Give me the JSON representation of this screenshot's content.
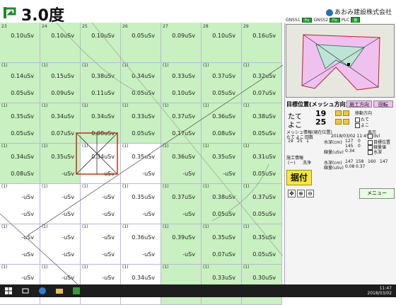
{
  "header": {
    "title": "3.0度",
    "brand": "あおみ建設株式会社"
  },
  "status": {
    "gnss1_label": "GNSS1",
    "gnss1_state": "Fix",
    "gnss2_label": "GNSS2",
    "gnss2_state": "Fix",
    "plc_label": "PLC",
    "plc_state": "接"
  },
  "grid": {
    "col_headers": [
      "23",
      "24",
      "25",
      "26",
      "27",
      "28",
      "29"
    ],
    "cell_marker": "(1)",
    "rows": [
      [
        {
          "v1": "0.10uSv",
          "v2": ""
        },
        {
          "v1": "0.10uSv",
          "v2": ""
        },
        {
          "v1": "0.10uSv",
          "v2": ""
        },
        {
          "v1": "0.05uSv",
          "v2": ""
        },
        {
          "v1": "0.09uSv",
          "v2": ""
        },
        {
          "v1": "0.10uSv",
          "v2": ""
        },
        {
          "v1": "0.16uSv",
          "v2": ""
        }
      ],
      [
        {
          "v1": "0.14uSv",
          "v2": "0.05uSv"
        },
        {
          "v1": "0.15uSv",
          "v2": "0.09uSv"
        },
        {
          "v1": "0.38uSv",
          "v2": "0.11uSv"
        },
        {
          "v1": "0.34uSv",
          "v2": "0.05uSv"
        },
        {
          "v1": "0.33uSv",
          "v2": "0.10uSv"
        },
        {
          "v1": "0.37uSv",
          "v2": "0.05uSv"
        },
        {
          "v1": "0.32uSv",
          "v2": "0.07uSv"
        }
      ],
      [
        {
          "v1": "0.35uSv",
          "v2": "0.05uSv"
        },
        {
          "v1": "0.34uSv",
          "v2": "0.07uSv"
        },
        {
          "v1": "0.34uSv",
          "v2": "0.08uSv"
        },
        {
          "v1": "0.33uSv",
          "v2": "0.05uSv"
        },
        {
          "v1": "0.37uSv",
          "v2": "0.17uSv"
        },
        {
          "v1": "0.36uSv",
          "v2": "0.08uSv"
        },
        {
          "v1": "0.38uSv",
          "v2": "0.05uSv"
        }
      ],
      [
        {
          "v1": "0.34uSv",
          "v2": "0.08uSv"
        },
        {
          "v1": "0.35uSv",
          "v2": "-uSv"
        },
        {
          "v1": "0.34uSv",
          "v2": "-uSv"
        },
        {
          "v1": "0.35uSv",
          "v2": "-uSv"
        },
        {
          "v1": "0.36uSv",
          "v2": "-uSv"
        },
        {
          "v1": "0.35uSv",
          "v2": "-uSv"
        },
        {
          "v1": "0.31uSv",
          "v2": "0.05uSv"
        }
      ],
      [
        {
          "v1": "-uSv",
          "v2": "-uSv"
        },
        {
          "v1": "-uSv",
          "v2": "-uSv"
        },
        {
          "v1": "-uSv",
          "v2": "-uSv"
        },
        {
          "v1": "0.35uSv",
          "v2": "-uSv"
        },
        {
          "v1": "0.37uSv",
          "v2": "-uSv"
        },
        {
          "v1": "0.38uSv",
          "v2": "0.05uSv"
        },
        {
          "v1": "0.37uSv",
          "v2": "0.05uSv"
        }
      ],
      [
        {
          "v1": "-uSv",
          "v2": "-uSv"
        },
        {
          "v1": "-uSv",
          "v2": "-uSv"
        },
        {
          "v1": "-uSv",
          "v2": "-uSv"
        },
        {
          "v1": "0.36uSv",
          "v2": "-uSv"
        },
        {
          "v1": "0.39uSv",
          "v2": "-uSv"
        },
        {
          "v1": "0.35uSv",
          "v2": "0.07uSv"
        },
        {
          "v1": "0.35uSv",
          "v2": "0.05uSv"
        }
      ],
      [
        {
          "v1": "-uSv",
          "v2": ""
        },
        {
          "v1": "-uSv",
          "v2": ""
        },
        {
          "v1": "-uSv",
          "v2": ""
        },
        {
          "v1": "0.34uSv",
          "v2": ""
        },
        {
          "v1": "",
          "v2": ""
        },
        {
          "v1": "0.33uSv",
          "v2": ""
        },
        {
          "v1": "0.30uSv",
          "v2": ""
        }
      ]
    ],
    "green": [
      [
        1,
        1,
        1,
        1,
        1,
        1,
        1
      ],
      [
        1,
        1,
        1,
        1,
        1,
        1,
        1
      ],
      [
        1,
        1,
        1,
        1,
        1,
        1,
        1
      ],
      [
        1,
        1,
        0,
        0,
        1,
        1,
        1
      ],
      [
        0,
        0,
        0,
        0,
        1,
        1,
        1
      ],
      [
        0,
        0,
        0,
        0,
        1,
        1,
        1
      ],
      [
        0,
        0,
        0,
        0,
        1,
        1,
        1
      ]
    ]
  },
  "panel": {
    "target_title": "目標位置(メッシュ方向)",
    "construction_dir_btn": "施工方向",
    "rotate_btn": "回転",
    "tate_label": "たて",
    "tate_value": "19",
    "yoko_label": "よこ",
    "yoko_value": "25",
    "move_dir_label": "移動方向",
    "move_tate": "たて",
    "move_yoko": "よこ",
    "mesh_info_title": "メッシュ情報(現在位置)",
    "mesh_tate": "たて",
    "mesh_yoko": "よこ",
    "mesh_count": "回数",
    "mesh_date": "2018/03/02 11:45",
    "mesh_tate_val": "19",
    "mesh_yoko_val": "25",
    "mesh_count_val": "1",
    "water_depth_label": "水深(cm)",
    "water_depth_val": "127",
    "water_depth_val2": "145",
    "water_depth_val3": "0",
    "dose_label": "線量(uSv)",
    "dose_val": "0.34",
    "dose_val2": "0",
    "display_label": "表示",
    "display_opt1": "dvl",
    "display_opt2": "目標位置",
    "display_opt3": "線量値",
    "display_opt4": "水深",
    "work_info_title": "施工情報",
    "work_mode": "(ー)",
    "work_wash": "洗浄",
    "work_depth_label": "水深(cm)",
    "work_depth_vals": [
      "147",
      "158",
      "160",
      "147"
    ],
    "work_dose_label": "線量(uSv)",
    "work_dose_vals": [
      "0.08",
      "0.37"
    ],
    "sueitsuke_btn": "据付",
    "menu_btn": "メニュー"
  },
  "taskbar": {
    "time": "11:47",
    "date": "2018/03/02"
  },
  "colors": {
    "cell_green": "#c8f0c0",
    "grid_line": "#b9b9d9",
    "accent_red": "#c0301a",
    "status_green": "#1e9e2e"
  }
}
